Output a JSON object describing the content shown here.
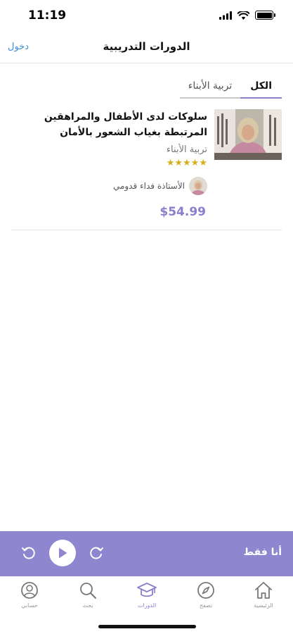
{
  "status_bar": {
    "time": "11:19"
  },
  "nav": {
    "title": "الدورات التدريبية",
    "login": "دخول"
  },
  "tabs": [
    {
      "label": "الكل",
      "active": true
    },
    {
      "label": "تربية الأبناء",
      "active": false
    }
  ],
  "course": {
    "title": "سلوكات لدى الأطفال والمراهقين المرتبطة بغياب الشعور بالأمان",
    "category": "تربية الأبناء",
    "rating": 5,
    "stars": "★★★★★",
    "instructor": "الأستاذة فداء قدومي",
    "price": "$54.99"
  },
  "player": {
    "label": "أنا فقط"
  },
  "tab_bar": {
    "items": [
      {
        "label": "الرئيسية",
        "icon": "home-icon"
      },
      {
        "label": "تصفح",
        "icon": "compass-icon"
      },
      {
        "label": "الدورات",
        "icon": "graduation-cap-icon",
        "active": true
      },
      {
        "label": "بحث",
        "icon": "search-icon"
      },
      {
        "label": "حسابي",
        "icon": "user-icon"
      }
    ]
  },
  "colors": {
    "accent": "#8a7fcc",
    "player_bg": "#8e86cf",
    "link": "#3d8bd9",
    "star": "#d6b01c"
  }
}
